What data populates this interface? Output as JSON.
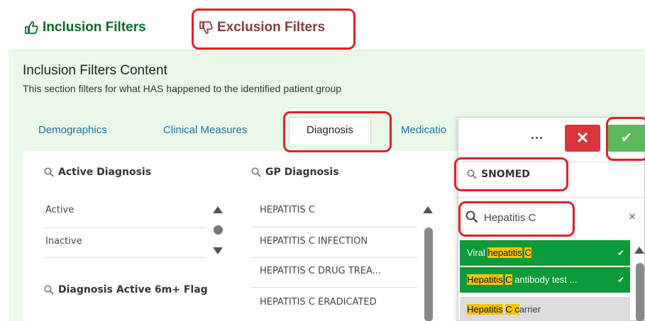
{
  "filter_tabs": {
    "inclusion": "Inclusion Filters",
    "exclusion": "Exclusion Filters"
  },
  "content": {
    "title": "Inclusion Filters Content",
    "subtitle": "This section filters for what HAS happened to the identified patient group"
  },
  "tabs": [
    "Demographics",
    "Clinical Measures",
    "Diagnosis",
    "Medicatio"
  ],
  "active_diagnosis": {
    "title": "Active Diagnosis",
    "items": [
      "Active",
      "Inactive"
    ]
  },
  "active_flag": {
    "title": "Diagnosis Active 6m+ Flag"
  },
  "gp_diagnosis": {
    "title": "GP Diagnosis",
    "items": [
      "HEPATITIS C",
      "HEPATITIS C INFECTION",
      "HEPATITIS C DRUG TREA...",
      "HEPATITIS C ERADICATED"
    ]
  },
  "popup": {
    "more_label": "...",
    "cancel_label": "✕",
    "confirm_label": "✔",
    "field_title": "SNOMED",
    "search_value": "Hepatitis C",
    "clear_label": "×",
    "results": [
      {
        "before": "Viral ",
        "hl1": "hepatitis",
        "mid": " ",
        "hl2": "C",
        "after": "",
        "state": "selected"
      },
      {
        "before": "",
        "hl1": "Hepatitis",
        "mid": " ",
        "hl2": "C",
        "after": " antibody test ...",
        "state": "selected"
      },
      {
        "before": "",
        "hl1": "Hepatitis",
        "mid": " ",
        "hl2": "C c",
        "after": "arrier",
        "state": "plain"
      }
    ]
  },
  "colors": {
    "inclusion_green": "#0b6b24",
    "exclusion_red": "#8a3a3f",
    "panel_bg": "#e9f8e9",
    "selected_green": "#0d9a3a",
    "highlight_yellow": "#f5c400",
    "annotation_red": "#e41f26"
  }
}
